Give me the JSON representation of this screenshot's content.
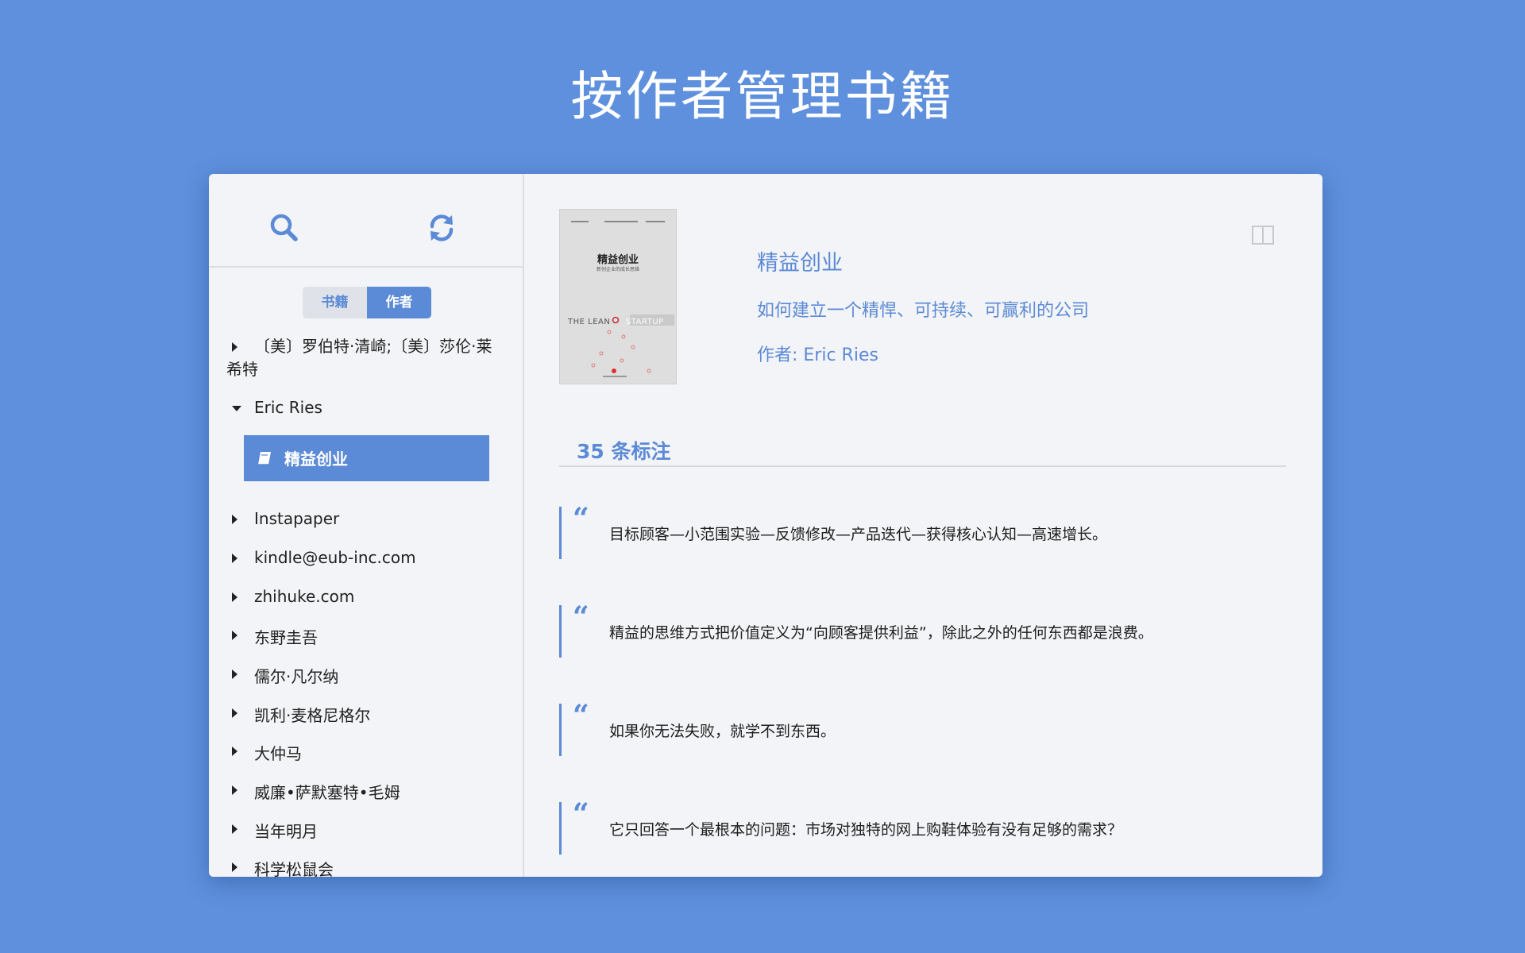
{
  "banner": {
    "title": "按作者管理书籍"
  },
  "sidebar": {
    "segments": [
      {
        "label": "书籍",
        "active": false
      },
      {
        "label": "作者",
        "active": true
      }
    ],
    "authors": [
      {
        "label": "〔美〕罗伯特·清崎;〔美〕莎伦·莱希特",
        "expanded": false
      },
      {
        "label": "Eric Ries",
        "expanded": true,
        "books": [
          "精益创业"
        ]
      },
      {
        "label": "Instapaper",
        "expanded": false
      },
      {
        "label": "kindle@eub-inc.com",
        "expanded": false
      },
      {
        "label": "zhihuke.com",
        "expanded": false
      },
      {
        "label": "东野圭吾",
        "expanded": false
      },
      {
        "label": "儒尔·凡尔纳",
        "expanded": false
      },
      {
        "label": "凯利·麦格尼格尔",
        "expanded": false
      },
      {
        "label": "大仲马",
        "expanded": false
      },
      {
        "label": "威廉•萨默塞特•毛姆",
        "expanded": false
      },
      {
        "label": "当年明月",
        "expanded": false
      },
      {
        "label": "科学松鼠会",
        "expanded": false
      }
    ],
    "selected_book": "精益创业"
  },
  "detail": {
    "cover": {
      "top_text": "Eric Ries",
      "title": "精益创业",
      "subtitle": "新创企业的成长思维",
      "lean": "THE LEAN",
      "startup": "STARTUP"
    },
    "title": "精益创业",
    "subtitle": "如何建立一个精悍、可持续、可赢利的公司",
    "author": "作者: Eric Ries",
    "notes_heading": "35 条标注",
    "quote_mark": "“",
    "notes": [
      "目标顾客—小范围实验—反馈修改—产品迭代—获得核心认知—高速增长。",
      "精益的思维方式把价值定义为“向顾客提供利益”，除此之外的任何东西都是浪费。",
      "如果你无法失败，就学不到东西。",
      "它只回答一个最根本的问题：市场对独特的网上购鞋体验有没有足够的需求？"
    ]
  },
  "colors": {
    "accent": "#5b8ad6",
    "background": "#5e90dd",
    "window": "#f3f4f7"
  },
  "icons": [
    "search-icon",
    "refresh-icon",
    "book-icon",
    "split-pane-icon"
  ]
}
